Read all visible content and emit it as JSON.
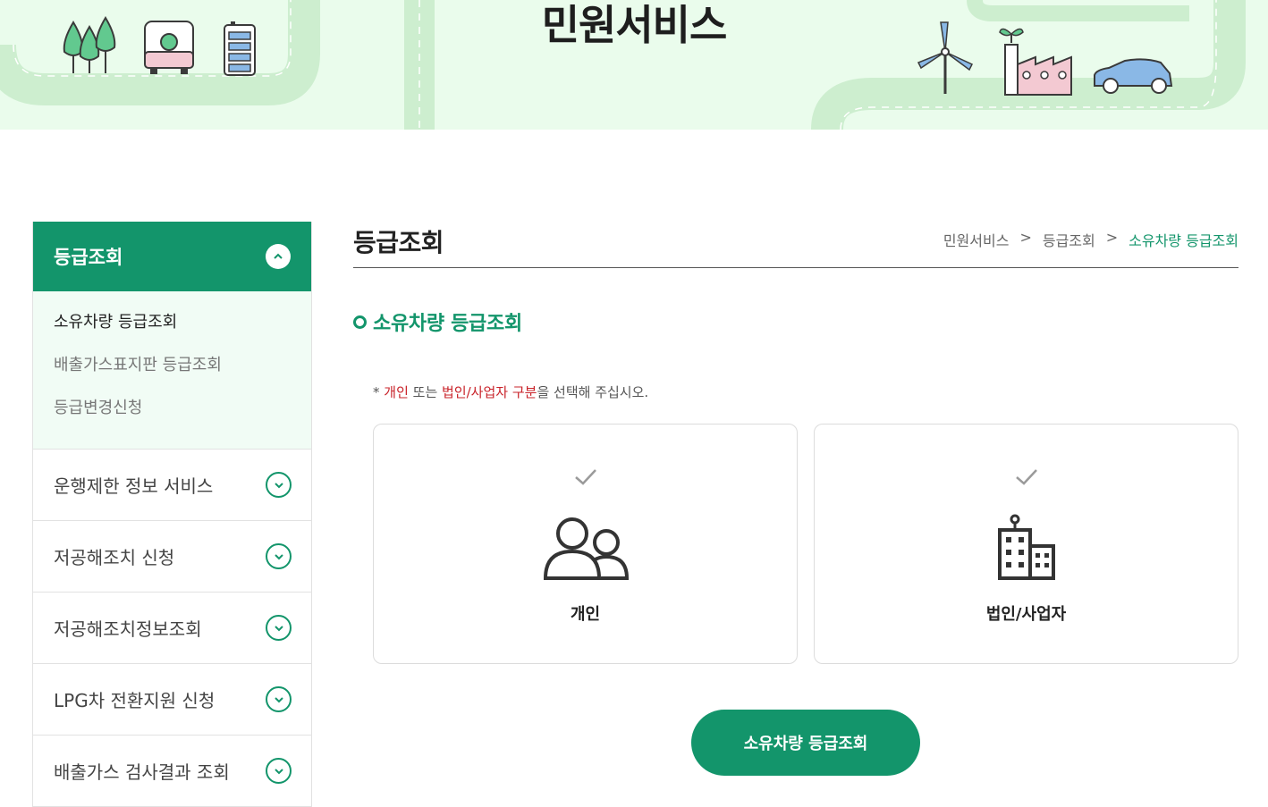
{
  "banner": {
    "title": "민원서비스"
  },
  "sidebar": {
    "active_group": {
      "label": "등급조회"
    },
    "sub_items": [
      {
        "label": "소유차량 등급조회"
      },
      {
        "label": "배출가스표지판 등급조회"
      },
      {
        "label": "등급변경신청"
      }
    ],
    "groups": [
      {
        "label": "운행제한 정보 서비스"
      },
      {
        "label": "저공해조치 신청"
      },
      {
        "label": "저공해조치정보조회"
      },
      {
        "label": "LPG차 전환지원 신청"
      },
      {
        "label": "배출가스 검사결과 조회"
      }
    ]
  },
  "content": {
    "title": "등급조회",
    "breadcrumb": [
      "민원서비스",
      ">",
      "등급조회",
      ">",
      "소유차량 등급조회"
    ],
    "section_title": "소유차량 등급조회",
    "notice": {
      "prefix": "* ",
      "red1": "개인",
      "mid": " 또는 ",
      "red2": "법인/사업자 구분",
      "suffix": "을 선택해 주십시오."
    },
    "options": [
      {
        "label": "개인",
        "icon": "people-icon"
      },
      {
        "label": "법인/사업자",
        "icon": "building-icon"
      }
    ],
    "submit_label": "소유차량 등급조회"
  },
  "colors": {
    "accent": "#13956b",
    "banner_bg": "#eafcec",
    "notice_red": "#c9232a"
  }
}
